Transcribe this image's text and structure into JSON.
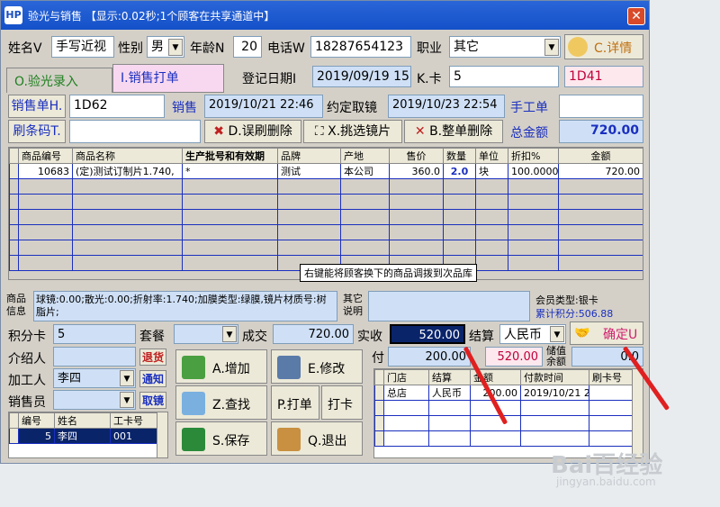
{
  "window": {
    "title": "验光与销售 【显示:0.02秒;1个顾客在共享通道中】",
    "icon_text": "HP"
  },
  "customer": {
    "name_label": "姓名V",
    "name": "手写近视",
    "gender_label": "性别",
    "gender": "男",
    "age_label": "年龄N",
    "age": "20",
    "phone_label": "电话W",
    "phone": "18287654123",
    "job_label": "职业",
    "job": "其它",
    "detail_btn": "C.详情"
  },
  "tabs": {
    "optometry": "O.验光录入",
    "sales": "I.销售打单"
  },
  "register": {
    "date_label": "登记日期I",
    "date": "2019/09/19 15",
    "card_label": "K.卡",
    "card": "5",
    "code": "1D41"
  },
  "sales": {
    "order_btn": "销售单H.",
    "order_no": "1D62",
    "sales_label": "销售",
    "sales_time": "2019/10/21 22:46",
    "pickup_label": "约定取镜",
    "pickup_time": "2019/10/23 22:54",
    "manual_label": "手工单",
    "manual": "",
    "barcode_btn": "刷条码T.",
    "barcode": "",
    "del_wrong": "D.误刷删除",
    "pick_lens": "X.挑选镜片",
    "del_all": "B.整单删除",
    "total_label": "总金额",
    "total": "720.00"
  },
  "grid": {
    "headers": [
      "商品编号",
      "商品名称",
      "生产批号和有效期",
      "品牌",
      "产地",
      "售价",
      "数量",
      "单位",
      "折扣%",
      "金额"
    ],
    "rows": [
      [
        "10683",
        "(定)测试订制片1.740,",
        "*",
        "测试",
        "本公司",
        "360.0",
        "2.0",
        "块",
        "100.0000",
        "720.00"
      ]
    ],
    "tooltip": "右键能将顾客换下的商品调拨到次品库"
  },
  "info": {
    "goods_label": "商品信息",
    "goods_text": "球镜:0.00;散光:0.00;折射率:1.740;加膜类型:绿膜,镜片材质号:树脂片;",
    "other_label": "其它说明",
    "other_text": "",
    "member_type": "会员类型:银卡",
    "points": "累计积分:506.88"
  },
  "payment": {
    "points_card_label": "积分卡",
    "points_card": "5",
    "package_label": "套餐",
    "package": "",
    "deal_label": "成交",
    "deal": "720.00",
    "paid_label": "实收",
    "paid": "520.00",
    "settle_label": "结算",
    "settle": "人民币",
    "confirm_btn": "确定U",
    "pay_label": "付",
    "pay": "200.00",
    "balance": "520.00",
    "stored_label": "储值余额",
    "stored": "0.0"
  },
  "staff": {
    "referrer_label": "介绍人",
    "referrer": "",
    "return_btn": "退货",
    "processor_label": "加工人",
    "processor": "李四",
    "notify_btn": "通知",
    "seller_label": "销售员",
    "seller": "",
    "pickup_btn": "取镜",
    "headers": [
      "编号",
      "姓名",
      "工卡号"
    ],
    "rows": [
      [
        "5",
        "李四",
        "001"
      ]
    ]
  },
  "actions": {
    "add": "A.增加",
    "edit": "E.修改",
    "find": "Z.查找",
    "print": "P.打单",
    "punch": "打卡",
    "save": "S.保存",
    "exit": "Q.退出"
  },
  "paylog": {
    "headers": [
      "门店",
      "结算",
      "金额",
      "付款时间",
      "刷卡号"
    ],
    "rows": [
      [
        "总店",
        "人民币",
        "200.00",
        "2019/10/21 2",
        ""
      ]
    ]
  },
  "watermark": {
    "logo": "Bai百经验",
    "url": "jingyan.baidu.com"
  },
  "colors": {
    "title_bar": "#1450c8",
    "accent_blue": "#1a2fbf",
    "pink": "#fde8ee",
    "arrow": "#e02020"
  }
}
